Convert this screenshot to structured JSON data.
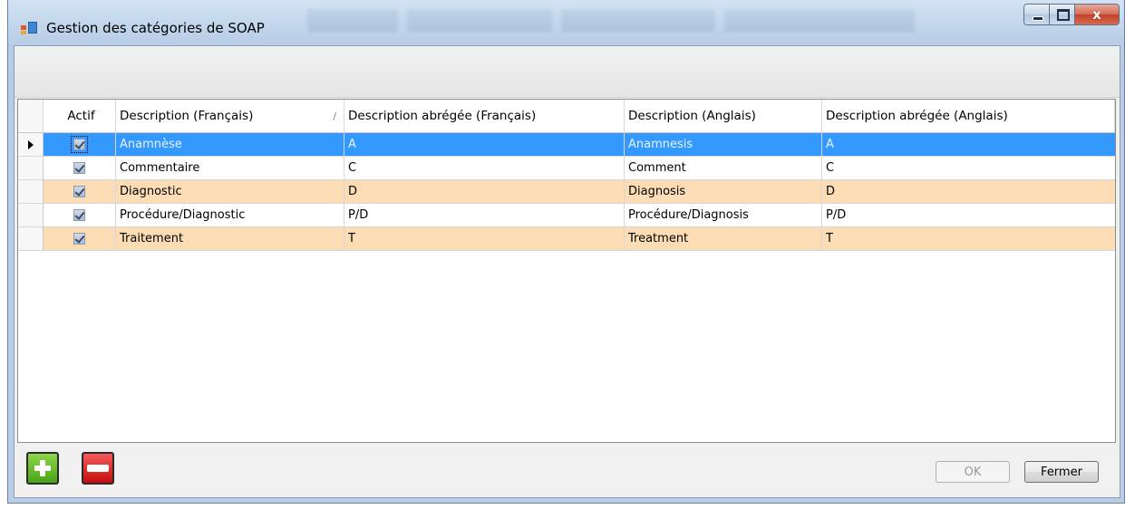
{
  "window": {
    "title": "Gestion des catégories de SOAP",
    "close_glyph": "x",
    "accent": "#3399ff"
  },
  "grid": {
    "columns": [
      "Actif",
      "Description (Français)",
      "Description abrégée (Français)",
      "Description (Anglais)",
      "Description abrégée (Anglais)"
    ],
    "sort_indicator": "/",
    "rows": [
      {
        "actif": true,
        "desc_fr": "Anamnèse",
        "abr_fr": "A",
        "desc_en": "Anamnesis",
        "abr_en": "A"
      },
      {
        "actif": true,
        "desc_fr": "Commentaire",
        "abr_fr": "C",
        "desc_en": "Comment",
        "abr_en": "C"
      },
      {
        "actif": true,
        "desc_fr": "Diagnostic",
        "abr_fr": "D",
        "desc_en": "Diagnosis",
        "abr_en": "D"
      },
      {
        "actif": true,
        "desc_fr": "Procédure/Diagnostic",
        "abr_fr": "P/D",
        "desc_en": "Procédure/Diagnosis",
        "abr_en": "P/D"
      },
      {
        "actif": true,
        "desc_fr": "Traitement",
        "abr_fr": "T",
        "desc_en": "Treatment",
        "abr_en": "T"
      }
    ],
    "colors": {
      "selected": "#3399ff",
      "alternate": "#fcdcb4"
    }
  },
  "footer": {
    "add_icon": "plus-icon",
    "remove_icon": "minus-icon",
    "ok_label": "OK",
    "close_label": "Fermer"
  }
}
